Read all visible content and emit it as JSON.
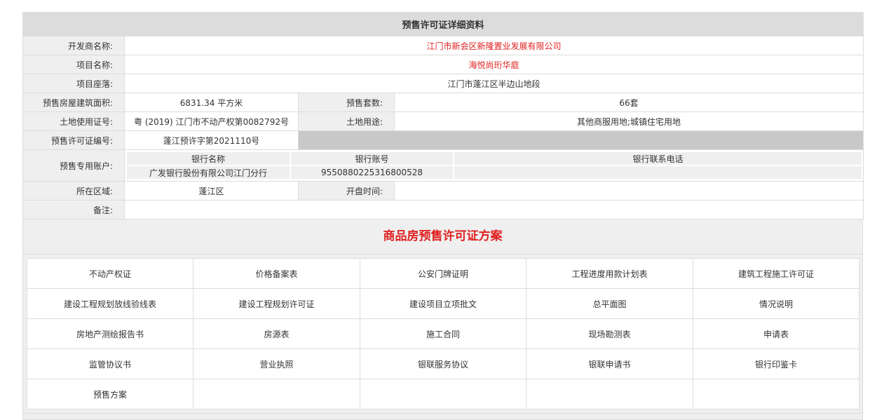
{
  "title": "预售许可证详细资料",
  "fields": {
    "developer_label": "开发商名称:",
    "developer": "江门市新会区新隆置业发展有限公司",
    "project_label": "项目名称:",
    "project": "海悦尚珩华庭",
    "location_label": "项目座落:",
    "location": "江门市蓬江区半边山地段",
    "area_label": "预售房屋建筑面积:",
    "area": "6831.34 平方米",
    "units_label": "预售套数:",
    "units": "66套",
    "land_cert_label": "土地使用证号:",
    "land_cert": "粤 (2019) 江门市不动产权第0082792号",
    "land_use_label": "土地用途:",
    "land_use": "其他商服用地;城镇住宅用地",
    "permit_no_label": "预售许可证编号:",
    "permit_no": "蓬江预许字第2021110号",
    "account_label": "预售专用账户:",
    "region_label": "所在区域:",
    "region": "蓬江区",
    "open_time_label": "开盘时间:",
    "open_time": "",
    "remarks_label": "备注:",
    "remarks": ""
  },
  "bank": {
    "headers": [
      "银行名称",
      "银行账号",
      "银行联系电话"
    ],
    "row": [
      "广发银行股份有限公司江门分行",
      "9550880225316800528",
      ""
    ]
  },
  "plan": {
    "title": "商品房预售许可证方案",
    "docs": [
      [
        "不动产权证",
        "价格备案表",
        "公安门牌证明",
        "工程进度用款计划表",
        "建筑工程施工许可证"
      ],
      [
        "建设工程规划放线验线表",
        "建设工程规划许可证",
        "建设项目立项批文",
        "总平面图",
        "情况说明"
      ],
      [
        "房地产测绘报告书",
        "房源表",
        "施工合同",
        "现场勘测表",
        "申请表"
      ],
      [
        "监管协议书",
        "营业执照",
        "银联服务协议",
        "银联申请书",
        "银行印鉴卡"
      ],
      [
        "预售方案",
        "",
        "",
        "",
        ""
      ]
    ]
  }
}
